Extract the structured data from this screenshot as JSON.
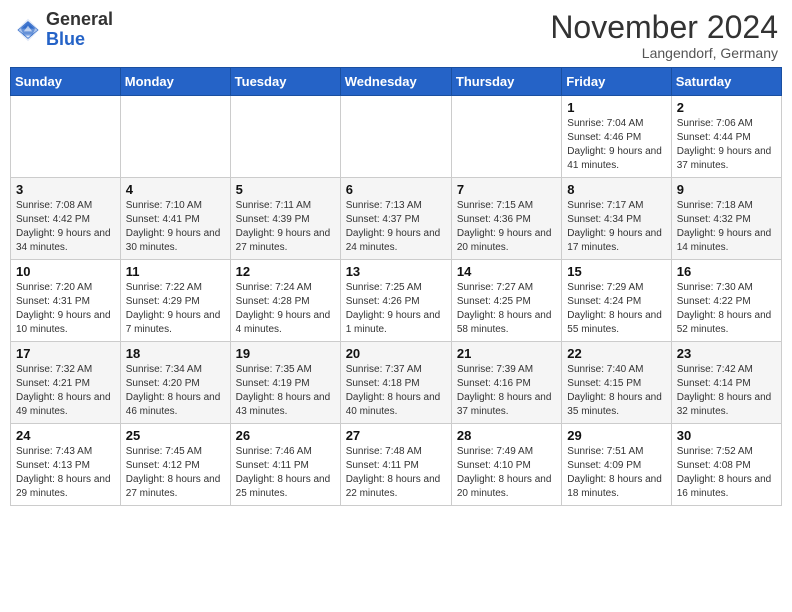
{
  "header": {
    "logo_general": "General",
    "logo_blue": "Blue",
    "month_title": "November 2024",
    "location": "Langendorf, Germany"
  },
  "weekdays": [
    "Sunday",
    "Monday",
    "Tuesday",
    "Wednesday",
    "Thursday",
    "Friday",
    "Saturday"
  ],
  "weeks": [
    [
      {
        "day": "",
        "info": ""
      },
      {
        "day": "",
        "info": ""
      },
      {
        "day": "",
        "info": ""
      },
      {
        "day": "",
        "info": ""
      },
      {
        "day": "",
        "info": ""
      },
      {
        "day": "1",
        "info": "Sunrise: 7:04 AM\nSunset: 4:46 PM\nDaylight: 9 hours and 41 minutes."
      },
      {
        "day": "2",
        "info": "Sunrise: 7:06 AM\nSunset: 4:44 PM\nDaylight: 9 hours and 37 minutes."
      }
    ],
    [
      {
        "day": "3",
        "info": "Sunrise: 7:08 AM\nSunset: 4:42 PM\nDaylight: 9 hours and 34 minutes."
      },
      {
        "day": "4",
        "info": "Sunrise: 7:10 AM\nSunset: 4:41 PM\nDaylight: 9 hours and 30 minutes."
      },
      {
        "day": "5",
        "info": "Sunrise: 7:11 AM\nSunset: 4:39 PM\nDaylight: 9 hours and 27 minutes."
      },
      {
        "day": "6",
        "info": "Sunrise: 7:13 AM\nSunset: 4:37 PM\nDaylight: 9 hours and 24 minutes."
      },
      {
        "day": "7",
        "info": "Sunrise: 7:15 AM\nSunset: 4:36 PM\nDaylight: 9 hours and 20 minutes."
      },
      {
        "day": "8",
        "info": "Sunrise: 7:17 AM\nSunset: 4:34 PM\nDaylight: 9 hours and 17 minutes."
      },
      {
        "day": "9",
        "info": "Sunrise: 7:18 AM\nSunset: 4:32 PM\nDaylight: 9 hours and 14 minutes."
      }
    ],
    [
      {
        "day": "10",
        "info": "Sunrise: 7:20 AM\nSunset: 4:31 PM\nDaylight: 9 hours and 10 minutes."
      },
      {
        "day": "11",
        "info": "Sunrise: 7:22 AM\nSunset: 4:29 PM\nDaylight: 9 hours and 7 minutes."
      },
      {
        "day": "12",
        "info": "Sunrise: 7:24 AM\nSunset: 4:28 PM\nDaylight: 9 hours and 4 minutes."
      },
      {
        "day": "13",
        "info": "Sunrise: 7:25 AM\nSunset: 4:26 PM\nDaylight: 9 hours and 1 minute."
      },
      {
        "day": "14",
        "info": "Sunrise: 7:27 AM\nSunset: 4:25 PM\nDaylight: 8 hours and 58 minutes."
      },
      {
        "day": "15",
        "info": "Sunrise: 7:29 AM\nSunset: 4:24 PM\nDaylight: 8 hours and 55 minutes."
      },
      {
        "day": "16",
        "info": "Sunrise: 7:30 AM\nSunset: 4:22 PM\nDaylight: 8 hours and 52 minutes."
      }
    ],
    [
      {
        "day": "17",
        "info": "Sunrise: 7:32 AM\nSunset: 4:21 PM\nDaylight: 8 hours and 49 minutes."
      },
      {
        "day": "18",
        "info": "Sunrise: 7:34 AM\nSunset: 4:20 PM\nDaylight: 8 hours and 46 minutes."
      },
      {
        "day": "19",
        "info": "Sunrise: 7:35 AM\nSunset: 4:19 PM\nDaylight: 8 hours and 43 minutes."
      },
      {
        "day": "20",
        "info": "Sunrise: 7:37 AM\nSunset: 4:18 PM\nDaylight: 8 hours and 40 minutes."
      },
      {
        "day": "21",
        "info": "Sunrise: 7:39 AM\nSunset: 4:16 PM\nDaylight: 8 hours and 37 minutes."
      },
      {
        "day": "22",
        "info": "Sunrise: 7:40 AM\nSunset: 4:15 PM\nDaylight: 8 hours and 35 minutes."
      },
      {
        "day": "23",
        "info": "Sunrise: 7:42 AM\nSunset: 4:14 PM\nDaylight: 8 hours and 32 minutes."
      }
    ],
    [
      {
        "day": "24",
        "info": "Sunrise: 7:43 AM\nSunset: 4:13 PM\nDaylight: 8 hours and 29 minutes."
      },
      {
        "day": "25",
        "info": "Sunrise: 7:45 AM\nSunset: 4:12 PM\nDaylight: 8 hours and 27 minutes."
      },
      {
        "day": "26",
        "info": "Sunrise: 7:46 AM\nSunset: 4:11 PM\nDaylight: 8 hours and 25 minutes."
      },
      {
        "day": "27",
        "info": "Sunrise: 7:48 AM\nSunset: 4:11 PM\nDaylight: 8 hours and 22 minutes."
      },
      {
        "day": "28",
        "info": "Sunrise: 7:49 AM\nSunset: 4:10 PM\nDaylight: 8 hours and 20 minutes."
      },
      {
        "day": "29",
        "info": "Sunrise: 7:51 AM\nSunset: 4:09 PM\nDaylight: 8 hours and 18 minutes."
      },
      {
        "day": "30",
        "info": "Sunrise: 7:52 AM\nSunset: 4:08 PM\nDaylight: 8 hours and 16 minutes."
      }
    ]
  ]
}
